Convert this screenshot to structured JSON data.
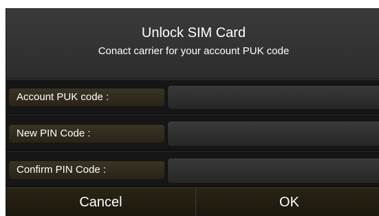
{
  "dialog": {
    "title": "Unlock SIM Card",
    "subtitle": "Conact carrier for your account PUK code"
  },
  "form": {
    "fields": [
      {
        "label": "Account PUK code :",
        "value": ""
      },
      {
        "label": "New PIN Code :",
        "value": ""
      },
      {
        "label": "Confirm PIN Code :",
        "value": ""
      }
    ]
  },
  "buttons": {
    "cancel_label": "Cancel",
    "ok_label": "OK"
  },
  "colors": {
    "background": "#2a2a2a",
    "label_gradient_top": "#3a3424",
    "button_gradient_top": "#2a2414",
    "text": "#ffffff"
  }
}
